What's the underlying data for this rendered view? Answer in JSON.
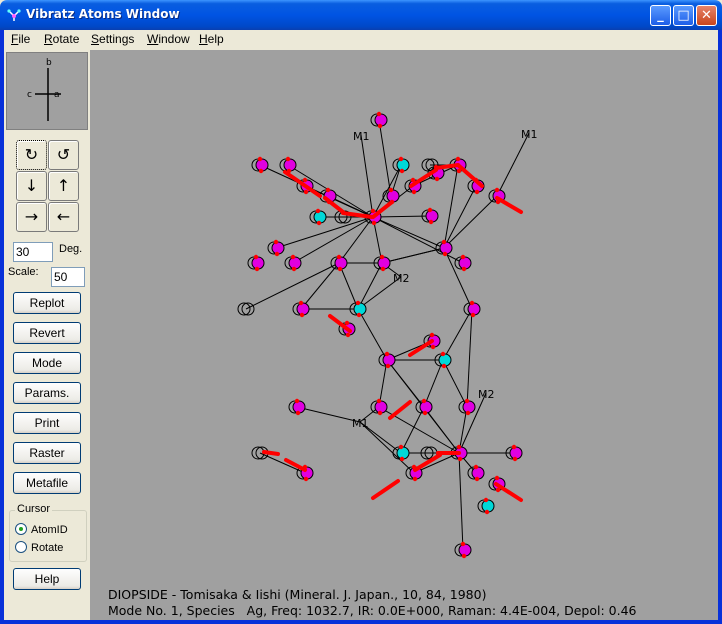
{
  "window": {
    "title": "Vibratz Atoms Window",
    "controls": {
      "minimize": "_",
      "maximize": "□",
      "close": "✕"
    }
  },
  "menu": [
    "File",
    "Rotate",
    "Settings",
    "Window",
    "Help"
  ],
  "axes": {
    "b": "b",
    "c": "c",
    "a": "a"
  },
  "rotation_buttons": [
    {
      "name": "rotate-clockwise",
      "glyph": "↻"
    },
    {
      "name": "rotate-counterclockwise",
      "glyph": "↺"
    },
    {
      "name": "rotate-down",
      "glyph": "↓"
    },
    {
      "name": "rotate-up",
      "glyph": "↑"
    },
    {
      "name": "rotate-right",
      "glyph": "→"
    },
    {
      "name": "rotate-left",
      "glyph": "←"
    }
  ],
  "controls": {
    "degrees_value": "30",
    "degrees_label": "Deg.",
    "scale_label": "Scale:",
    "scale_value": "50"
  },
  "buttons": {
    "replot": "Replot",
    "revert": "Revert",
    "mode": "Mode",
    "params": "Params.",
    "print": "Print",
    "raster": "Raster",
    "metafile": "Metafile",
    "help": "Help"
  },
  "cursor": {
    "legend": "Cursor",
    "options": [
      "AtomID",
      "Rotate"
    ],
    "selected": "AtomID"
  },
  "colors": {
    "atom_magenta": "#e000e0",
    "atom_cyan": "#00d8d8",
    "displacement": "#ff0000",
    "background": "#a0a0a0"
  },
  "atom_labels": {
    "m1": "M1",
    "m2": "M2"
  },
  "caption": {
    "line1": "DIOPSIDE - Tomisaka & Iishi (Mineral. J. Japan., 10, 84, 1980)",
    "line2": "Mode No. 1, Species   Ag, Freq: 1032.7, IR: 0.0E+000, Raman: 4.4E-004, Depol: 0.46"
  }
}
